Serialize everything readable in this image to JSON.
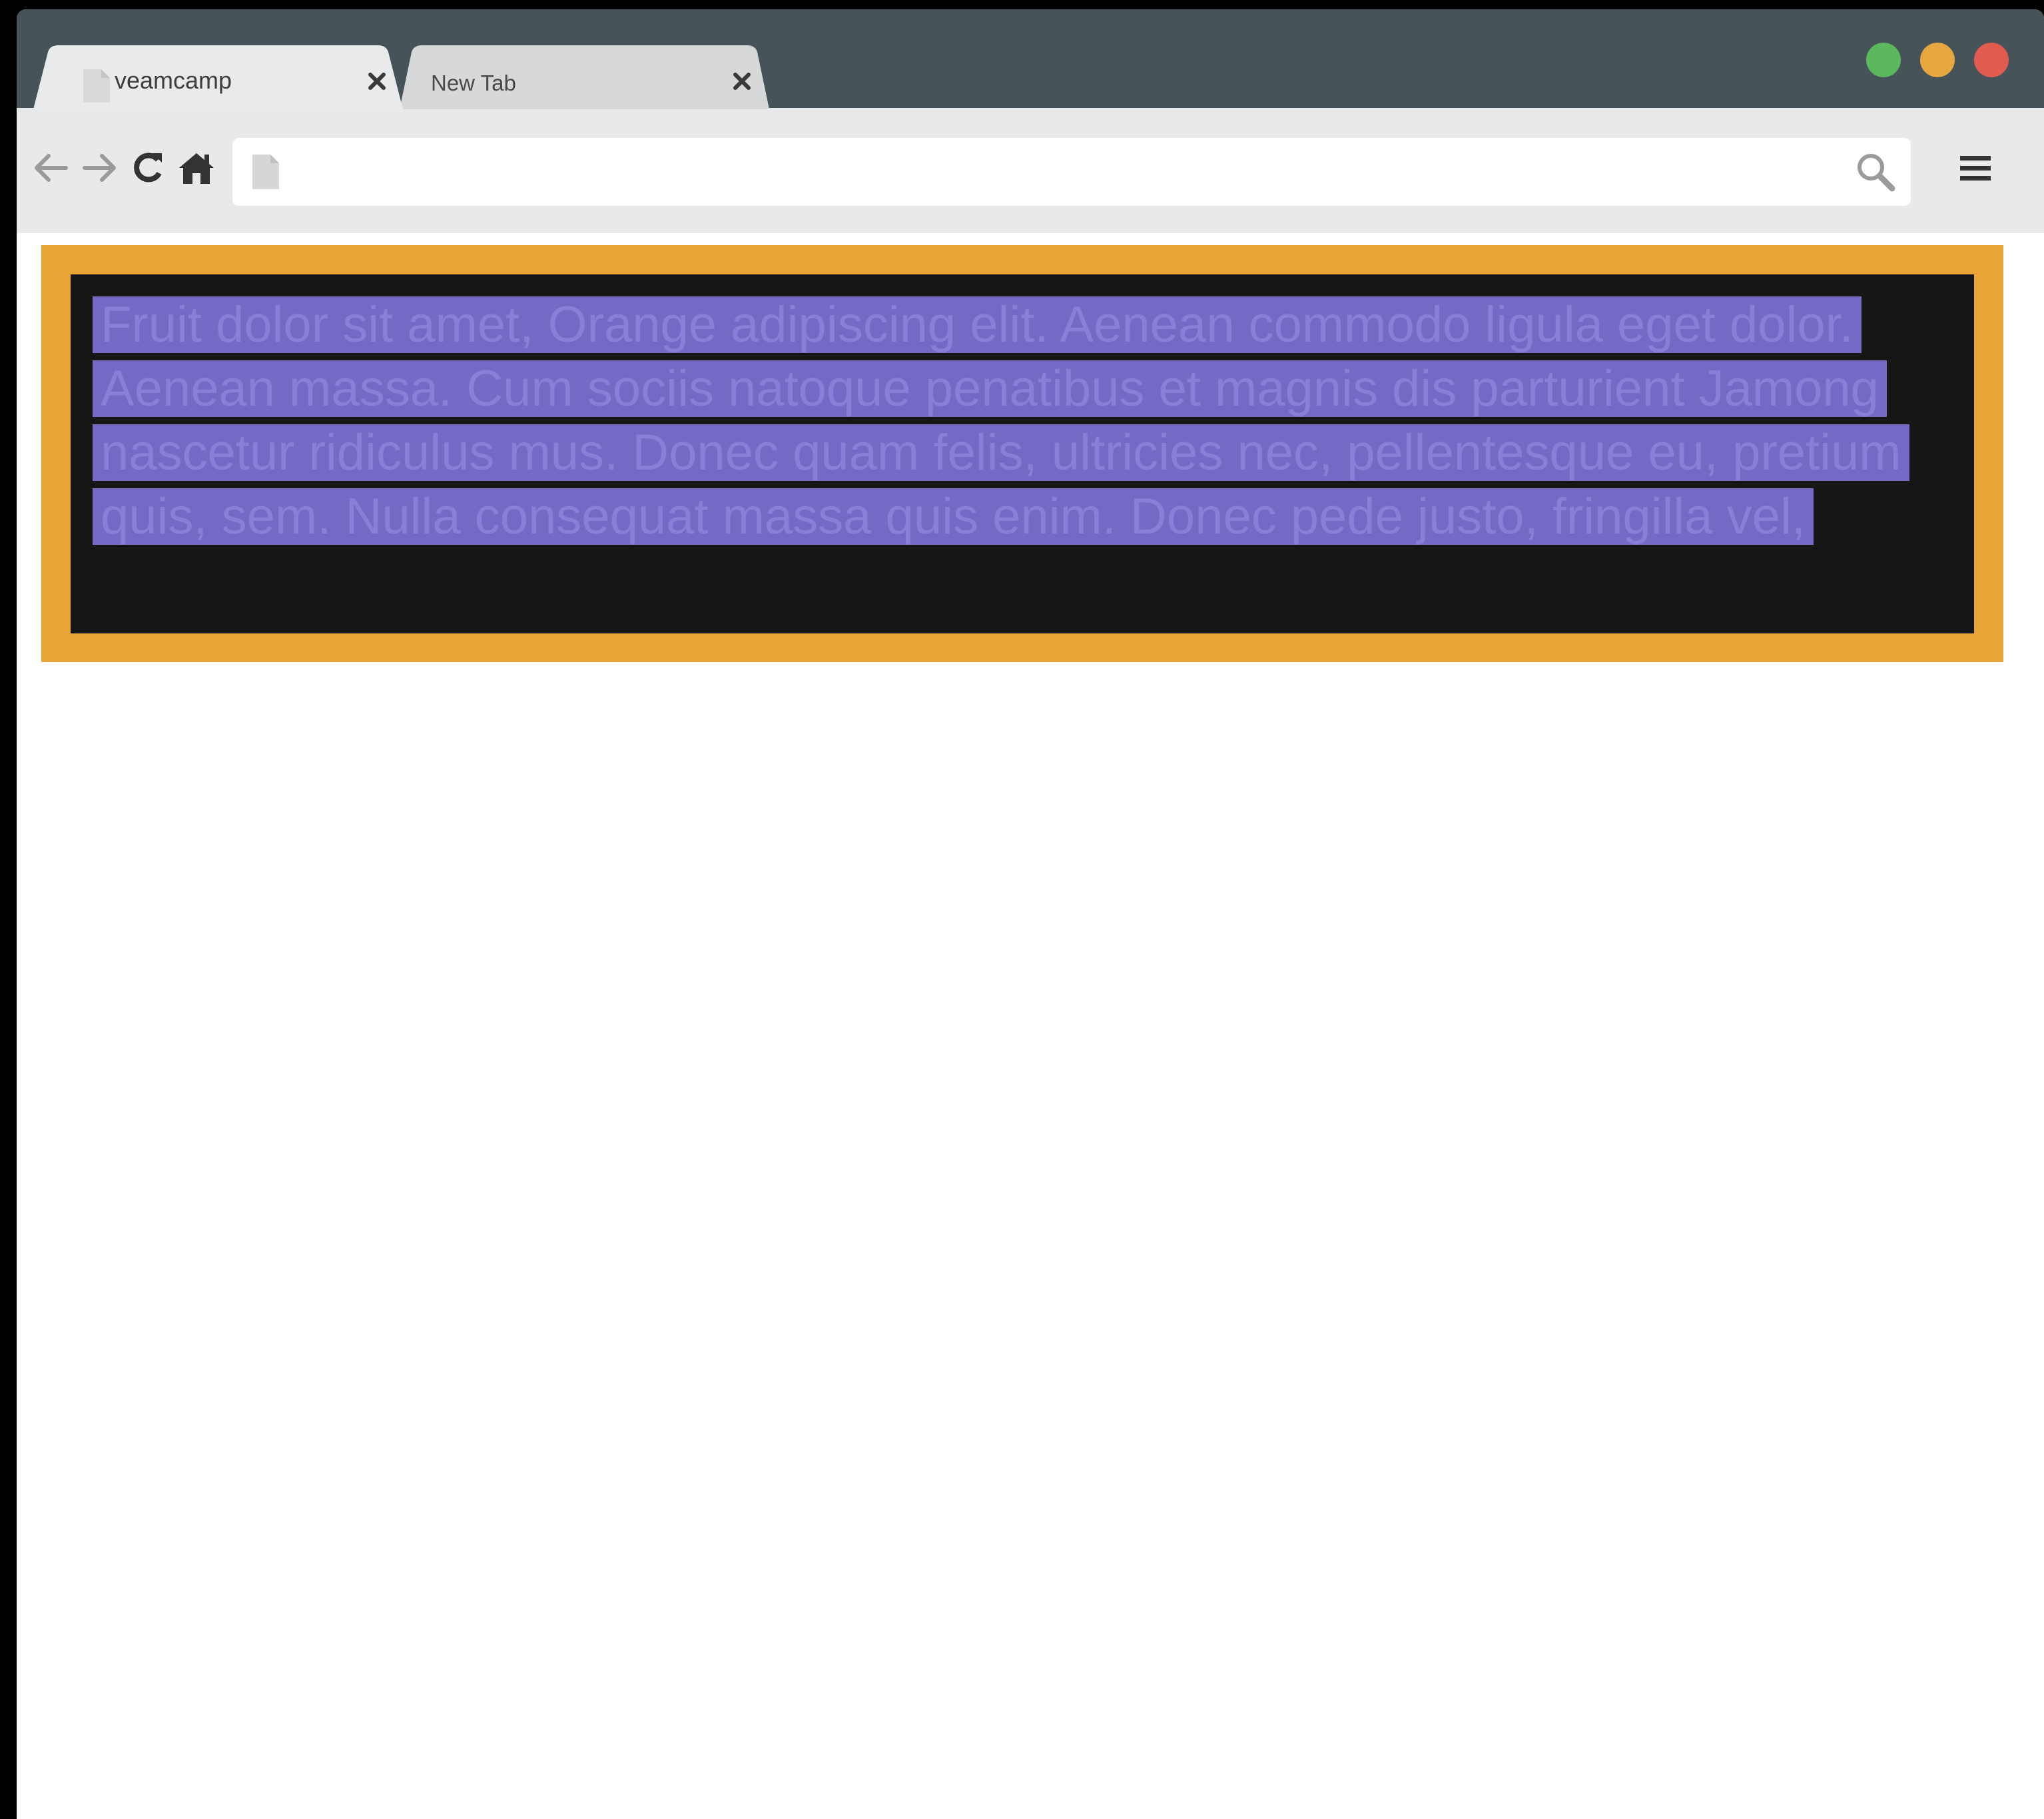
{
  "browser": {
    "tabs": [
      {
        "label": "veamcamp",
        "active": true
      },
      {
        "label": "New Tab",
        "active": false
      }
    ],
    "address_bar": {
      "value": "",
      "placeholder": ""
    },
    "window_controls": {
      "green": "#5cb85c",
      "yellow": "#e6a83e",
      "red": "#e15b4f"
    },
    "icons": {
      "back": "arrow-left-icon",
      "forward": "arrow-right-icon",
      "reload": "reload-icon",
      "home": "home-icon",
      "page": "page-icon",
      "search": "search-icon",
      "menu": "hamburger-menu-icon",
      "close": "close-icon"
    }
  },
  "content": {
    "paragraph": "Fruit dolor sit amet, Orange adipiscing elit. Aenean commodo ligula eget dolor. Aenean massa. Cum sociis natoque penatibus et magnis dis parturient Jamong nascetur ridiculus mus. Donec quam felis, ultricies nec, pellentesque eu, pretium quis, sem. Nulla consequat massa quis enim. Donec pede justo, fringilla vel,",
    "colors": {
      "frame": "#e8a435",
      "panel": "#161616",
      "selection": "#7569c6",
      "text": "#8a7fd8"
    }
  }
}
